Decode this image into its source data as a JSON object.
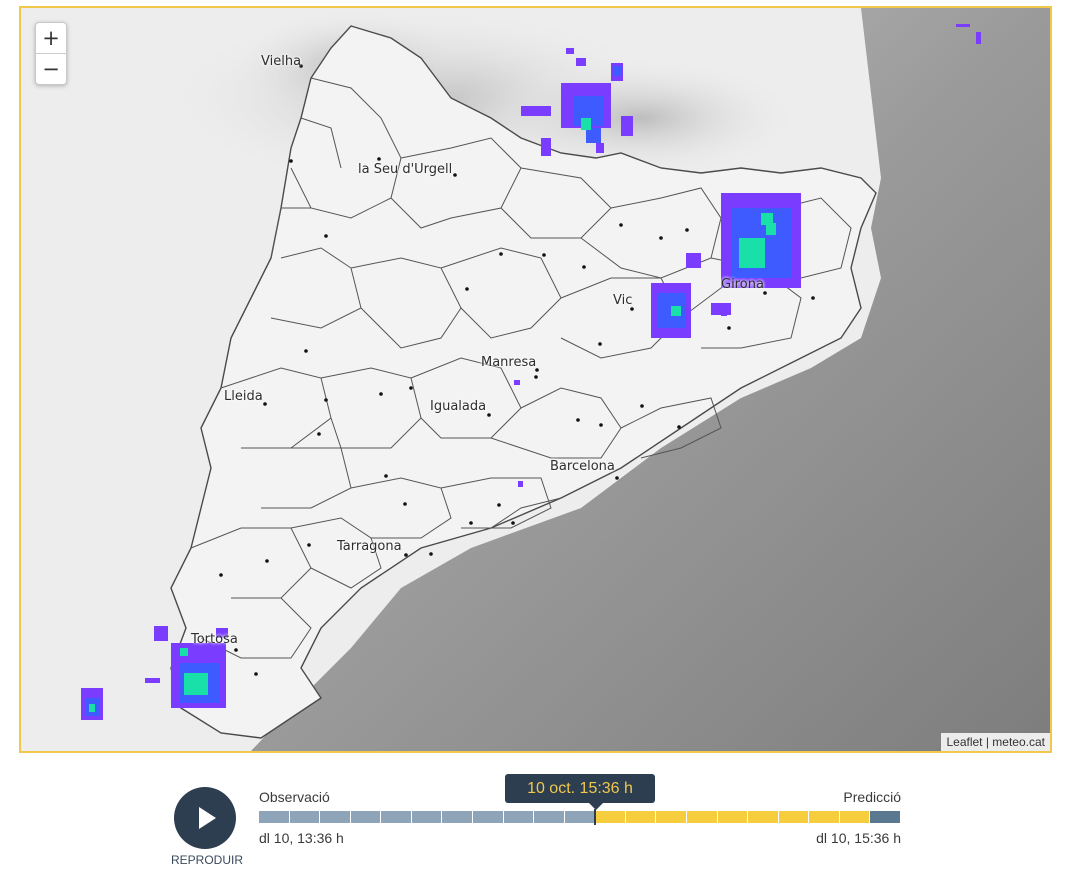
{
  "map": {
    "zoom_in": "+",
    "zoom_out": "−",
    "attribution_leaflet": "Leaflet",
    "attribution_sep": " | ",
    "attribution_source": "meteo.cat",
    "cities": {
      "vielha": "Vielha",
      "seu_urgell": "la Seu d'Urgell",
      "vic": "Vic",
      "girona": "Girona",
      "manresa": "Manresa",
      "lleida": "Lleida",
      "igualada": "Igualada",
      "barcelona": "Barcelona",
      "tarragona": "Tarragona",
      "tortosa": "Tortosa"
    },
    "colors": {
      "border": "#f2c84b",
      "land": "#f1f1f1",
      "sea": "#8a8a8a",
      "radar_low": "#7a3cff",
      "radar_mid": "#3d5bff",
      "radar_high": "#18e0a8"
    }
  },
  "player": {
    "play_label": "REPRODUIR",
    "observation_label": "Observació",
    "prediction_label": "Predicció",
    "current_time": "10 oct. 15:36 h",
    "start_time": "dl 10, 13:36 h",
    "end_time": "dl 10, 15:36 h",
    "colors": {
      "observation": "#8ea4b8",
      "prediction": "#f5cd3d",
      "future": "#5b7891",
      "button": "#2c3e50"
    }
  }
}
